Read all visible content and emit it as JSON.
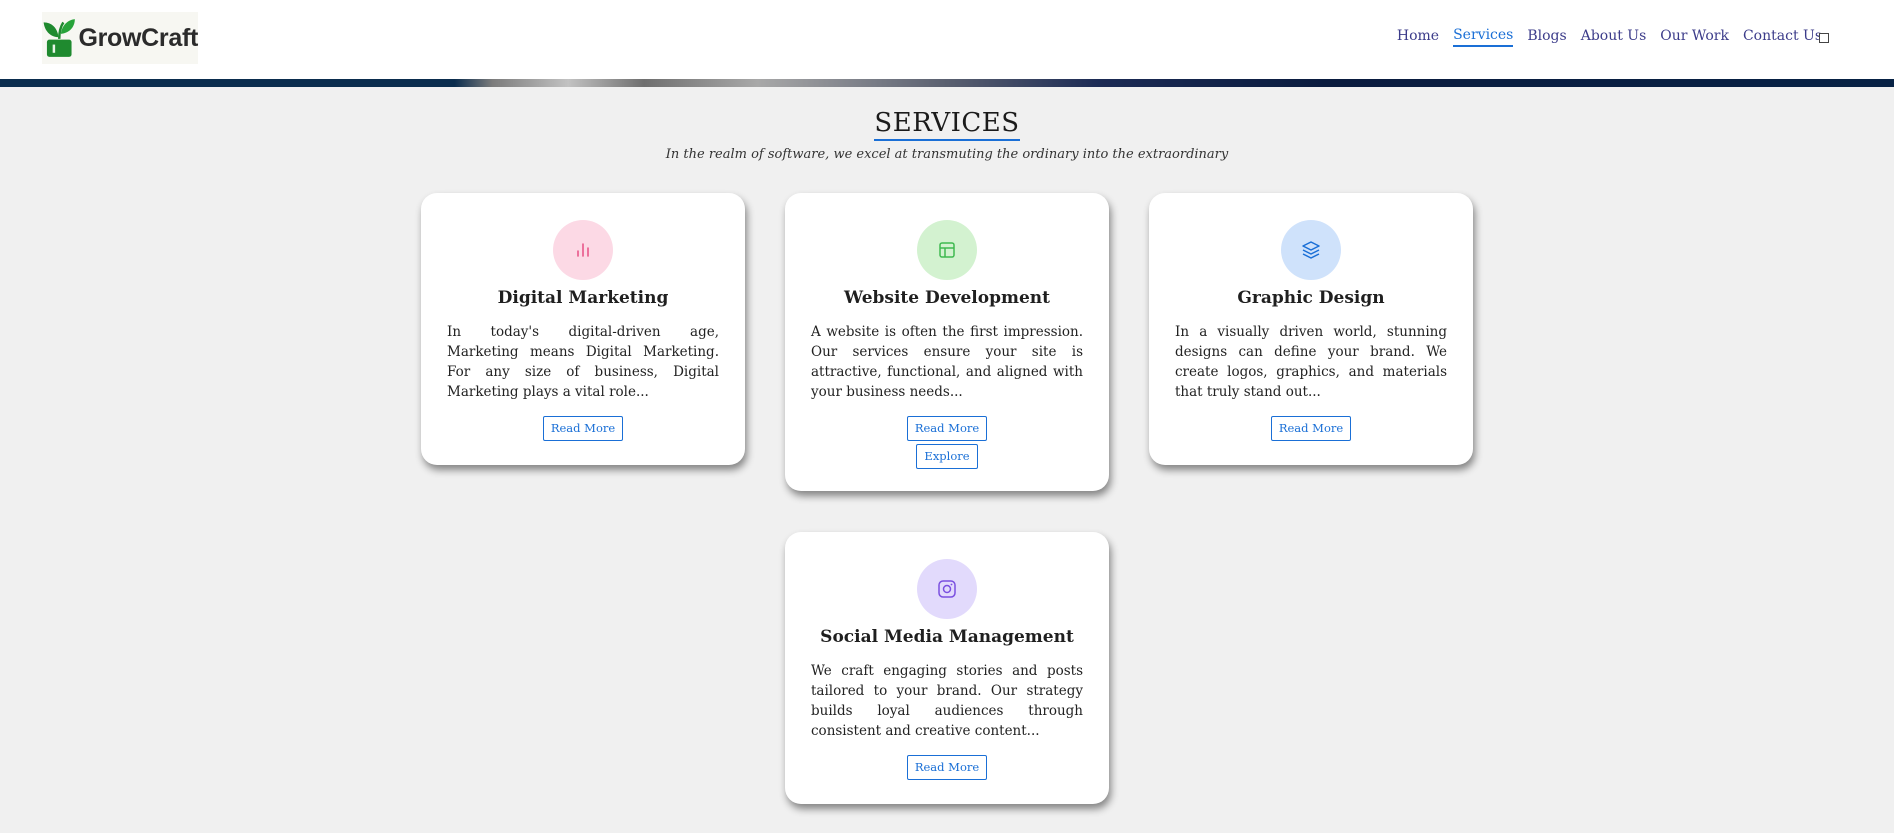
{
  "header": {
    "brand": "GrowCraft",
    "nav": [
      "Home",
      "Services",
      "Blogs",
      "About Us",
      "Our Work",
      "Contact Us"
    ],
    "active_nav": "Services"
  },
  "section": {
    "title": "SERVICES",
    "subtitle": "In the realm of software, we excel at transmuting the ordinary into the extraordinary"
  },
  "cards": [
    {
      "title": "Digital Marketing",
      "text": "In today's digital-driven age, Marketing means Digital Marketing. For any size of business, Digital Marketing plays a vital role...",
      "button": "Read More",
      "icon": "bar-chart-icon",
      "icon_bg": "#fcd9e5",
      "icon_color": "#e8578a"
    },
    {
      "title": "Website Development",
      "text": "A website is often the first impression. Our services ensure your site is attractive, functional, and aligned with your business needs...",
      "button": "Read More",
      "button2": "Explore",
      "icon": "layout-icon",
      "icon_bg": "#d3f2d0",
      "icon_color": "#3fb950"
    },
    {
      "title": "Graphic Design",
      "text": "In a visually driven world, stunning designs can define your brand. We create logos, graphics, and materials that truly stand out...",
      "button": "Read More",
      "icon": "layers-icon",
      "icon_bg": "#cfe2fb",
      "icon_color": "#1a6fd6"
    },
    {
      "title": "Social Media Management",
      "text": "We craft engaging stories and posts tailored to your brand. Our strategy builds loyal audiences through consistent and creative content...",
      "button": "Read More",
      "icon": "instagram-icon",
      "icon_bg": "#e2dafc",
      "icon_color": "#7a4fe0"
    }
  ]
}
